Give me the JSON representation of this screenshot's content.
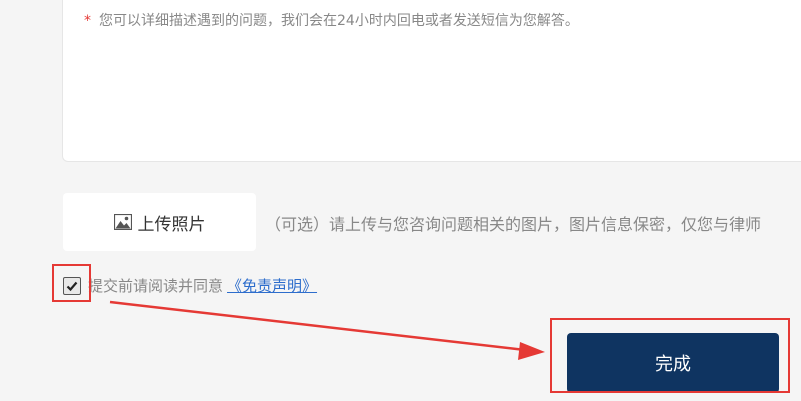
{
  "question_box": {
    "required_mark": "*",
    "placeholder": "您可以详细描述遇到的问题，我们会在24小时内回电或者发送短信为您解答。"
  },
  "upload": {
    "icon": "image-icon",
    "label": "上传照片",
    "hint": "（可选）请上传与您咨询问题相关的图片，图片信息保密，仅您与律师"
  },
  "agreement": {
    "checked": true,
    "text": "提交前请阅读并同意",
    "link": "《免责声明》"
  },
  "submit": {
    "label": "完成"
  },
  "annotation": {
    "color": "#e53935"
  }
}
